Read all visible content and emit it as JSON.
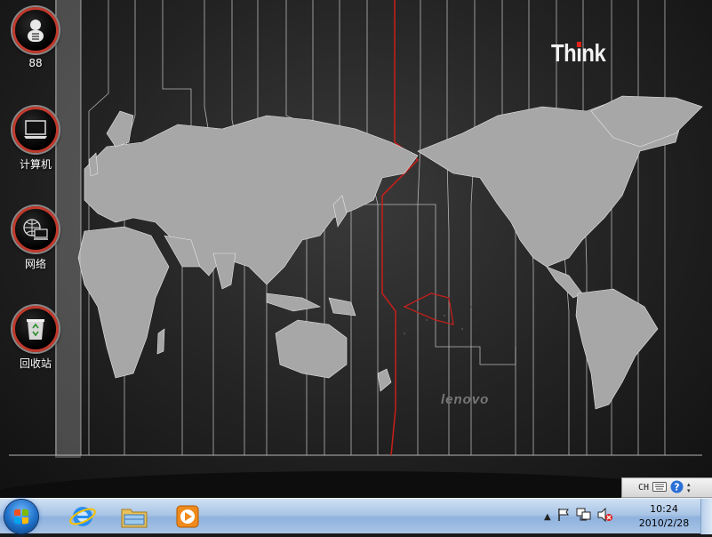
{
  "brand": {
    "think": "Think",
    "lenovo": "lenovo"
  },
  "desktop_icons": [
    {
      "label": "88",
      "icon": "user-icon"
    },
    {
      "label": "计算机",
      "icon": "computer-icon"
    },
    {
      "label": "网络",
      "icon": "network-icon"
    },
    {
      "label": "回收站",
      "icon": "recycle-bin-icon"
    }
  ],
  "tray_bar": {
    "language": "CH",
    "icons": [
      "keyboard-icon",
      "help-icon"
    ]
  },
  "taskbar": {
    "pinned": [
      "internet-explorer-icon",
      "windows-explorer-icon",
      "media-player-icon"
    ],
    "systray_icons": [
      "show-hidden-icons-arrow",
      "action-center-flag-icon",
      "network-icon",
      "volume-muted-icon"
    ],
    "clock": {
      "time": "10:24",
      "date": "2010/2/28"
    }
  },
  "colors": {
    "accent_red": "#e2231a",
    "taskbar": "#a9c5e6"
  }
}
